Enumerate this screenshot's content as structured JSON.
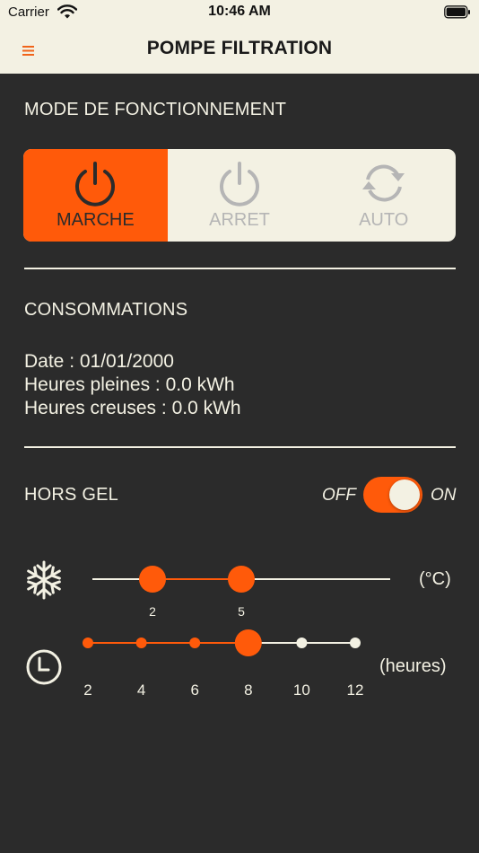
{
  "status_bar": {
    "carrier": "Carrier",
    "time": "10:46 AM"
  },
  "nav": {
    "title": "POMPE FILTRATION",
    "menu_icon": "hamburger-menu-icon"
  },
  "mode": {
    "title": "MODE DE FONCTIONNEMENT",
    "options": [
      {
        "label": "MARCHE",
        "icon": "power-icon",
        "selected": true
      },
      {
        "label": "ARRET",
        "icon": "power-icon",
        "selected": false
      },
      {
        "label": "AUTO",
        "icon": "refresh-icon",
        "selected": false
      }
    ]
  },
  "consumption": {
    "title": "CONSOMMATIONS",
    "date": "Date : 01/01/2000",
    "peak": "Heures pleines : 0.0 kWh",
    "offpeak": "Heures creuses : 0.0 kWh"
  },
  "frost": {
    "title": "HORS GEL",
    "off_label": "OFF",
    "on_label": "ON",
    "enabled": true,
    "temperature": {
      "icon": "snowflake-icon",
      "unit": "(°C)",
      "min": 0,
      "max": 8,
      "low": 2,
      "high": 5,
      "low_label": "2",
      "high_label": "5"
    },
    "duration": {
      "icon": "clock-icon",
      "unit": "(heures)",
      "steps": [
        2,
        4,
        6,
        8,
        10,
        12
      ],
      "step_labels": [
        "2",
        "4",
        "6",
        "8",
        "10",
        "12"
      ],
      "value": 8
    }
  },
  "colors": {
    "accent": "#ff5a0a",
    "background": "#2b2b2b",
    "light": "#f3f1e3",
    "inactive": "#b5b5b5"
  }
}
